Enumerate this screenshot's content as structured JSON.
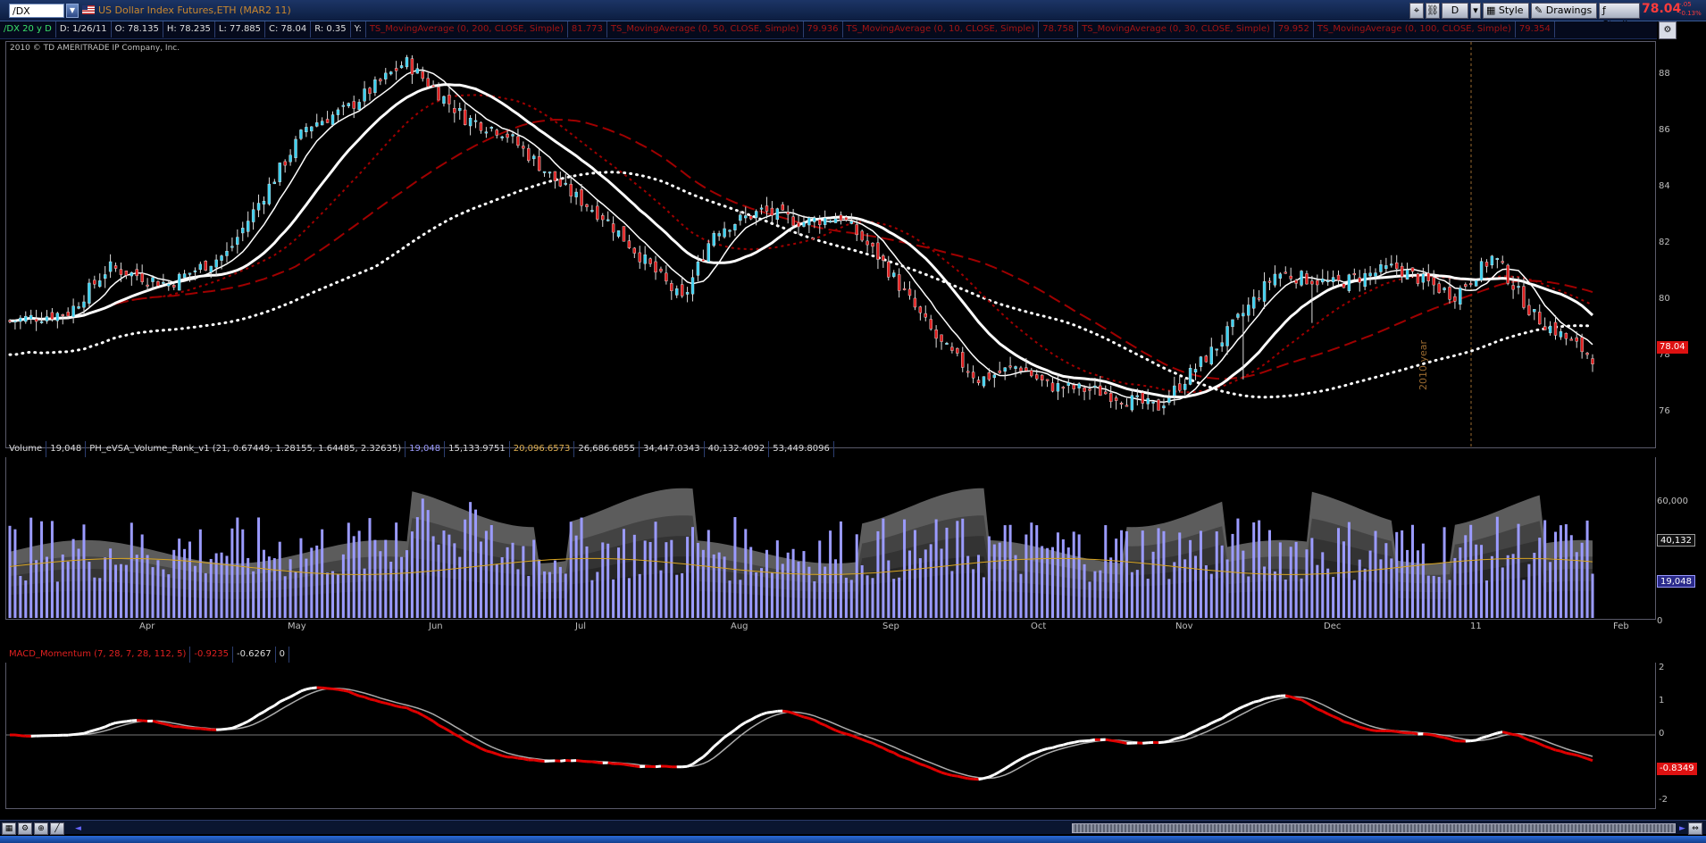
{
  "top": {
    "symbol": "/DX",
    "description": "US Dollar Index Futures,ETH (MAR2 11)",
    "period_button": "D",
    "style_label": "Style",
    "drawings_label": "Drawings",
    "studies_label": "Studies",
    "last_price": "78.04",
    "change_1": "-.05",
    "change_2": "-0.13%"
  },
  "info": {
    "symbol_period": "/DX 20 y D",
    "date": "D: 1/26/11",
    "open": "O: 78.135",
    "high": "H: 78.235",
    "low": "L: 77.885",
    "close": "C: 78.04",
    "range": "R: 0.35",
    "y": "Y:",
    "studies": [
      {
        "label": "TS_MovingAverage (0, 200, CLOSE, Simple)",
        "value": "81.773"
      },
      {
        "label": "TS_MovingAverage (0, 50, CLOSE, Simple)",
        "value": "79.936"
      },
      {
        "label": "TS_MovingAverage (0, 10, CLOSE, Simple)",
        "value": "78.758"
      },
      {
        "label": "TS_MovingAverage (0, 30, CLOSE, Simple)",
        "value": "79.952"
      },
      {
        "label": "TS_MovingAverage (0, 100, CLOSE, Simple)",
        "value": "79.354"
      }
    ]
  },
  "price_pane": {
    "copyright": "2010 © TD AMERITRADE IP Company, Inc.",
    "y_ticks": [
      "88",
      "86",
      "84",
      "82",
      "80",
      "78",
      "76"
    ],
    "last_label": "78.04",
    "year_marker": "2010 year"
  },
  "volume_pane": {
    "title": "Volume",
    "volume": "19,048",
    "study": "PH_eVSA_Volume_Rank_v1 (21, 0.67449, 1.28155, 1.64485, 2.32635)",
    "v1": "19,048",
    "v2": "15,133.9751",
    "v3": "20,096.6573",
    "v4": "26,686.6855",
    "v5": "34,447.0343",
    "v6": "40,132.4092",
    "v7": "53,449.8096",
    "y_ticks": [
      "60,000",
      "0"
    ],
    "label_a": "40,132",
    "label_b": "19,048",
    "x_labels": [
      "Apr",
      "May",
      "Jun",
      "Jul",
      "Aug",
      "Sep",
      "Oct",
      "Nov",
      "Dec",
      "11",
      "Feb"
    ]
  },
  "macd_pane": {
    "title": "MACD_Momentum (7, 28, 7, 28, 112, 5)",
    "v1": "-0.9235",
    "v2": "-0.6267",
    "v3": "0",
    "y_ticks": [
      "2",
      "1",
      "0",
      "-1",
      "-2"
    ],
    "last_label": "-0.8349"
  },
  "colors": {
    "up": "#3ad0f0",
    "down": "#e02020",
    "ma_white": "#ffffff",
    "ma_red": "#a00000",
    "vol_bar": "#9b9bff",
    "macd_red": "#e00000",
    "accent": "#ff3b3b"
  },
  "icons": [
    "settings-icon",
    "drawing-icon",
    "studies-icon",
    "style-icon",
    "chart-setup-icon"
  ]
}
